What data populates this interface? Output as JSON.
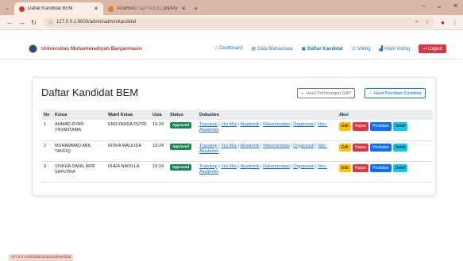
{
  "browser": {
    "tabs": [
      {
        "title": "Daftar Kandidat BEM",
        "active": true,
        "fav_color": "#c0392b"
      },
      {
        "title": "localhost / 127.0.0.1 | phpMyAd...",
        "active": false,
        "fav_color": "#e67e22"
      }
    ],
    "new_tab": "+",
    "url": "127.0.0.1:8000/admin/admin/kandidat",
    "win_min": "–",
    "win_restore": "⌄",
    "win_close": "✕"
  },
  "navbar": {
    "brand": "Universitas Muhammadiyah Banjarmasin",
    "links": [
      {
        "icon": "⌂",
        "label": "Dashboard",
        "active": false
      },
      {
        "icon": "▤",
        "label": "Data Mahasiswa",
        "active": false
      },
      {
        "icon": "▣",
        "label": "Daftar Kandidat",
        "active": true
      },
      {
        "icon": "⊙",
        "label": "Voting",
        "active": false
      },
      {
        "icon": "▟",
        "label": "Hasil Voting",
        "active": false
      }
    ],
    "logout": "Logout"
  },
  "page": {
    "title": "Daftar Kandidat BEM",
    "btn_gap": "Hasil Perhitungan GAP",
    "btn_penilaian": "Hasil Penilaian Kandidat"
  },
  "table": {
    "headers": [
      "No",
      "Ketua",
      "Wakil Ketua",
      "Usia",
      "Status",
      "Dokumen",
      "Aksi"
    ],
    "doc_labels": [
      "Transkrip",
      "Visi Misi",
      "Akademik",
      "Rekomendasi",
      "Organisasi",
      "Non-Akademik"
    ],
    "actions": [
      "Edit",
      "Hapus",
      "Penilaian",
      "Detail"
    ],
    "rows": [
      {
        "no": "1",
        "ketua": "AHMAD RYAN TRYANTAMA",
        "wakil": "EMILYANDA PUTRI",
        "usia": "19-24",
        "status": "Approved"
      },
      {
        "no": "2",
        "ketua": "MUHAMMAD ABIL TAUFIQ",
        "wakil": "RISKA MAULIDA",
        "usia": "19-24",
        "status": "Approved"
      },
      {
        "no": "3",
        "ketua": "SISKHA DANIL ARIF SAFUTRA",
        "wakil": "DHEA NADILLA",
        "usia": "19-24",
        "status": "Approved"
      }
    ]
  },
  "status_url": "127.0.0.1:8000/admin/admin/kandidat"
}
